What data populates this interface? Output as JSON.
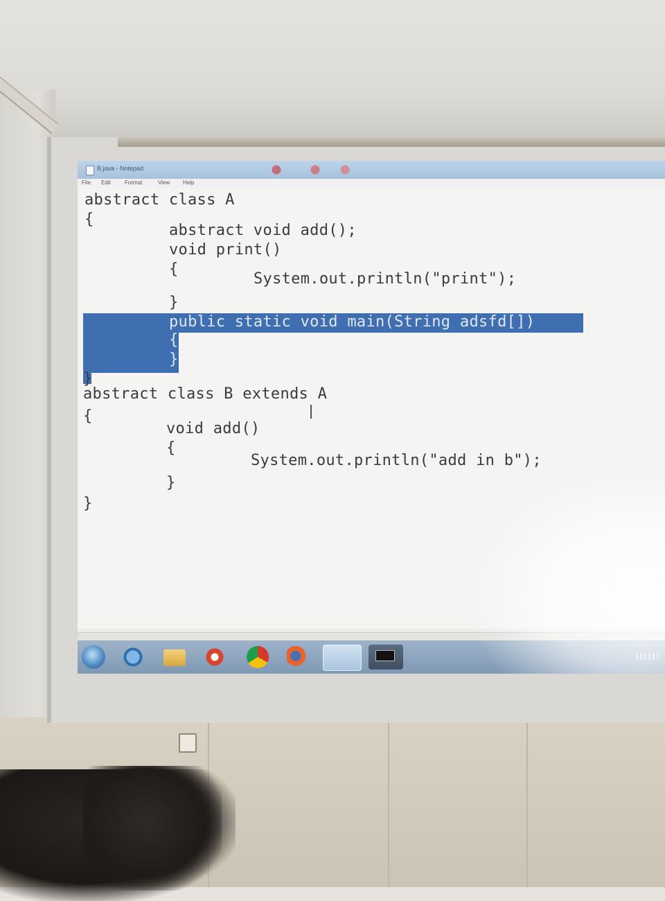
{
  "window": {
    "title": "B.java - Notepad"
  },
  "menu": [
    "File",
    "Edit",
    "Format",
    "View",
    "Help"
  ],
  "code": {
    "lines": [
      "abstract class A",
      "{",
      "abstract void add();",
      "void print()",
      "{",
      "System.out.println(\"print\");",
      "}",
      "public static void main(String adsfd[])",
      "{",
      "}",
      "}",
      "abstract class B extends A",
      "{",
      "void add()",
      "{",
      "System.out.println(\"add in b\");",
      "}",
      "}"
    ]
  },
  "taskbar": {
    "items": [
      "start-orb",
      "internet-explorer-icon",
      "folder-icon",
      "media-player-icon",
      "chrome-icon",
      "firefox-icon",
      "notepad-icon",
      "command-prompt-icon"
    ]
  },
  "colors": {
    "selection": "#3f6fb0",
    "text": "#3b3b3b",
    "taskbar": "#8fa6bf"
  }
}
